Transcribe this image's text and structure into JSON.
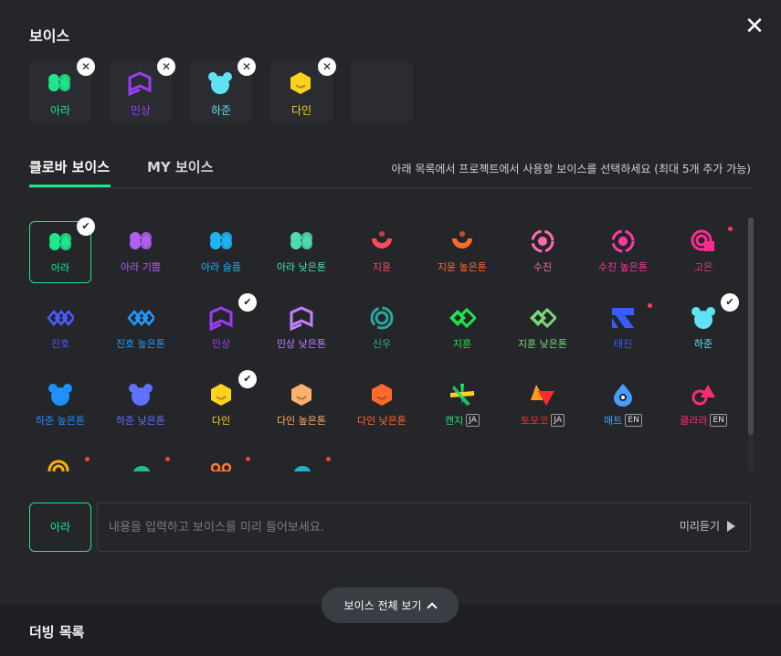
{
  "header": {
    "title": "보이스",
    "close_icon": "close-icon"
  },
  "selected": [
    {
      "id": "ara",
      "name": "아라",
      "color": "#1ee68c",
      "icon": "hearts-icon"
    },
    {
      "id": "minsang",
      "name": "민상",
      "color": "#9b3cf5",
      "icon": "book-icon"
    },
    {
      "id": "hajun",
      "name": "하준",
      "color": "#5fe3f2",
      "icon": "bear-icon"
    },
    {
      "id": "dain",
      "name": "다인",
      "color": "#ffd21e",
      "icon": "hexagon-face-icon"
    }
  ],
  "tabs": {
    "clova": "클로바 보이스",
    "my": "MY 보이스"
  },
  "hint": "아래 목록에서 프로젝트에서 사용할 보이스를 선택하세요 (최대 5개 추가 가능)",
  "voices": [
    {
      "id": "ara",
      "name": "아라",
      "color": "#1ee68c",
      "shape": "hearts",
      "current": true,
      "checked": true
    },
    {
      "id": "ara-joy",
      "name": "아라 기쁨",
      "color": "#b05ff0",
      "shape": "hearts"
    },
    {
      "id": "ara-sad",
      "name": "아라 슬픔",
      "color": "#1eb4f5",
      "shape": "hearts"
    },
    {
      "id": "ara-low",
      "name": "아라 낮은톤",
      "color": "#50dcb0",
      "shape": "hearts"
    },
    {
      "id": "jiyun",
      "name": "지윤",
      "color": "#ff4a5a",
      "shape": "bowl"
    },
    {
      "id": "jiyun-high",
      "name": "지윤 높은톤",
      "color": "#ff6a2a",
      "shape": "bowl"
    },
    {
      "id": "sujin",
      "name": "수진",
      "color": "#ff6ab0",
      "shape": "target"
    },
    {
      "id": "sujin-high",
      "name": "수진 높은톤",
      "color": "#ff3aa0",
      "shape": "target"
    },
    {
      "id": "goeun",
      "name": "고은",
      "color": "#ff2a90",
      "shape": "spiral",
      "dot": true
    },
    {
      "id": "jinho",
      "name": "진호",
      "color": "#4a5cff",
      "shape": "chain"
    },
    {
      "id": "jinho-high",
      "name": "진호 높은톤",
      "color": "#1e9cff",
      "shape": "chain"
    },
    {
      "id": "minsang",
      "name": "민상",
      "color": "#9b3cf5",
      "shape": "book",
      "checked": true
    },
    {
      "id": "minsang-low",
      "name": "민상 낮은톤",
      "color": "#c080ff",
      "shape": "book"
    },
    {
      "id": "sinu",
      "name": "신우",
      "color": "#2aa8a0",
      "shape": "ring"
    },
    {
      "id": "jihun",
      "name": "지훈",
      "color": "#1ee64a",
      "shape": "links"
    },
    {
      "id": "jihun-low",
      "name": "지훈 낮은톤",
      "color": "#7ad878",
      "shape": "links"
    },
    {
      "id": "taejin",
      "name": "태진",
      "color": "#3a5cff",
      "shape": "tshape",
      "dot": true
    },
    {
      "id": "hajun",
      "name": "하준",
      "color": "#5fe3f2",
      "shape": "bear",
      "checked": true
    },
    {
      "id": "hajun-high",
      "name": "하준 높은톤",
      "color": "#1e90ff",
      "shape": "bear"
    },
    {
      "id": "hajun-low",
      "name": "하준 낮은톤",
      "color": "#6070ff",
      "shape": "bear"
    },
    {
      "id": "dain",
      "name": "다인",
      "color": "#ffd21e",
      "shape": "hex",
      "checked": true
    },
    {
      "id": "dain-high",
      "name": "다인 높은톤",
      "color": "#ffb06a",
      "shape": "hex"
    },
    {
      "id": "dain-low",
      "name": "다인 낮은톤",
      "color": "#ff6a2a",
      "shape": "hex"
    },
    {
      "id": "kaenji",
      "name": "캔지",
      "badge": "JA",
      "color": "#20e070",
      "shape": "star"
    },
    {
      "id": "tomoko",
      "name": "토모코",
      "badge": "JA",
      "color": "#ff2a2a",
      "shape": "triangles"
    },
    {
      "id": "matt",
      "name": "매트",
      "badge": "EN",
      "color": "#4a9cff",
      "shape": "drop"
    },
    {
      "id": "clara",
      "name": "클라라",
      "badge": "EN",
      "color": "#ff2a70",
      "shape": "clara"
    },
    {
      "id": "partial-1",
      "name": "",
      "color": "#ffb000",
      "shape": "spiral",
      "dot": true
    },
    {
      "id": "partial-2",
      "name": "",
      "color": "#20c080",
      "shape": "blob",
      "dot": true
    },
    {
      "id": "partial-3",
      "name": "",
      "color": "#ff7a2a",
      "shape": "flower",
      "dot": true
    },
    {
      "id": "partial-4",
      "name": "",
      "color": "#1eb4d0",
      "shape": "blob",
      "dot": true
    }
  ],
  "preview": {
    "voice": "아라",
    "placeholder": "내용을 입력하고 보이스를 미리 들어보세요.",
    "play_label": "미리듣기"
  },
  "expand_label": "보이스 전체 보기",
  "dubbing_title": "더빙 목록"
}
